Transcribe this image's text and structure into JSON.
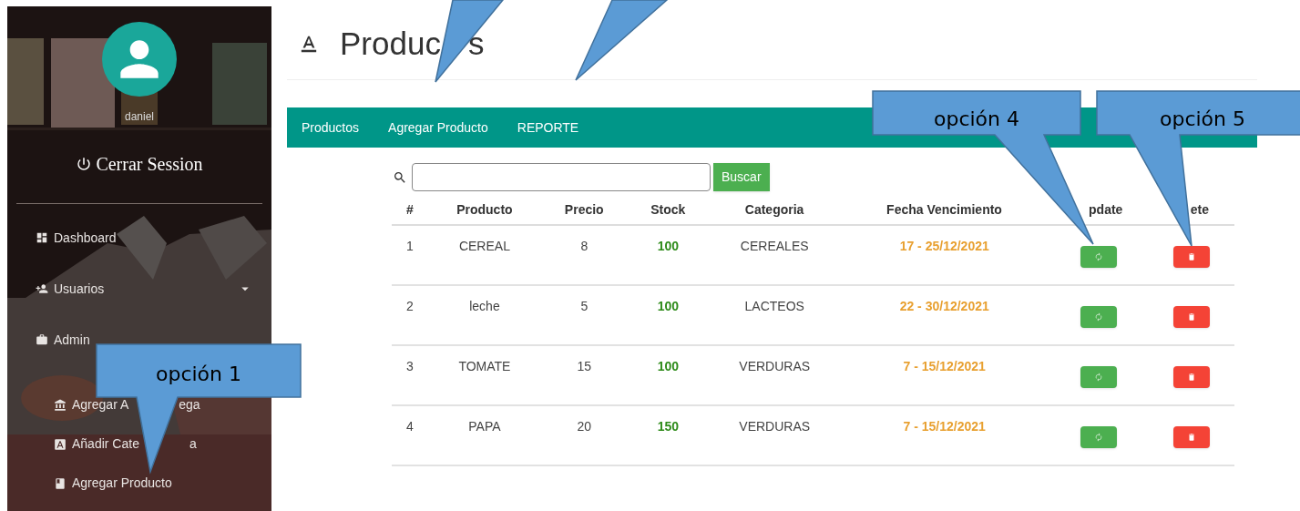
{
  "sidebar": {
    "user_name": "daniel",
    "logout": "Cerrar Session",
    "items": [
      {
        "kind": "dashboard",
        "label": "Dashboard",
        "has_submenu": false
      },
      {
        "kind": "users",
        "label": "Usuarios",
        "has_submenu": true
      },
      {
        "kind": "briefcase",
        "label": "Admin",
        "has_submenu": false,
        "children": [
          {
            "kind": "bank",
            "label": "Agregar A",
            "label_tail": "ega",
            "has_submenu": false
          },
          {
            "kind": "letter_box",
            "label": "Añadir Cate",
            "label_tail": "a",
            "has_submenu": false
          },
          {
            "kind": "book",
            "label": "Agregar Producto",
            "has_submenu": false
          }
        ]
      }
    ]
  },
  "page": {
    "title": "Produc",
    "title_tail": "s"
  },
  "nav_tabs": [
    {
      "label": "Productos"
    },
    {
      "label": "Agregar Producto"
    },
    {
      "label": "REPORTE"
    }
  ],
  "search": {
    "button": "Buscar"
  },
  "table": {
    "columns": [
      {
        "kind": "plain",
        "label": "#"
      },
      {
        "kind": "plain",
        "label": "Producto"
      },
      {
        "kind": "plain",
        "label": "Precio"
      },
      {
        "kind": "stock",
        "label": "Stock"
      },
      {
        "kind": "plain",
        "label": "Categoria"
      },
      {
        "kind": "date",
        "label": "Fecha Vencimiento"
      },
      {
        "kind": "update",
        "label": "pdate"
      },
      {
        "kind": "delete",
        "label": "ete"
      }
    ],
    "rows": [
      {
        "cells": [
          "1",
          "CEREAL",
          "8",
          "100",
          "CEREALES",
          "17 - 25/12/2021"
        ]
      },
      {
        "cells": [
          "2",
          "leche",
          "5",
          "100",
          "LACTEOS",
          "22 - 30/12/2021"
        ]
      },
      {
        "cells": [
          "3",
          "TOMATE",
          "15",
          "100",
          "VERDURAS",
          "7 - 15/12/2021"
        ]
      },
      {
        "cells": [
          "4",
          "PAPA",
          "20",
          "150",
          "VERDURAS",
          "7 - 15/12/2021"
        ]
      }
    ]
  },
  "callouts": [
    {
      "kind": "pointer"
    },
    {
      "kind": "pointer"
    },
    {
      "kind": "labeled",
      "text": "opción 1"
    },
    {
      "kind": "labeled",
      "text": "opción 4"
    },
    {
      "kind": "labeled",
      "text": "opción 5"
    }
  ]
}
